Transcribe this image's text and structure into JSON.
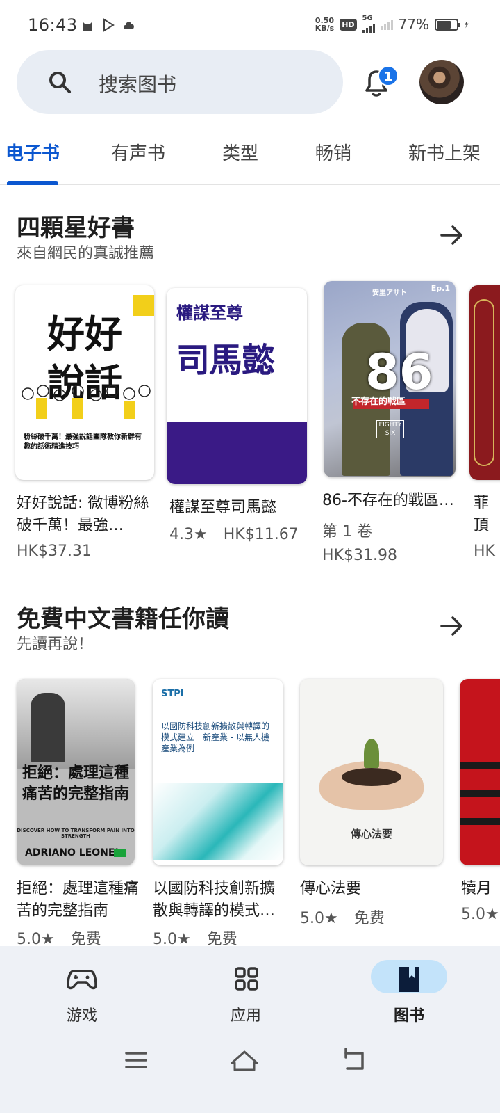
{
  "status_bar": {
    "time": "16:43",
    "net_speed_value": "0.50",
    "net_speed_unit": "KB/s",
    "hd_label": "HD",
    "network_label": "5G",
    "battery_percent": "77%",
    "battery_level": 0.77
  },
  "header": {
    "search_placeholder": "搜索图书",
    "notification_count": "1"
  },
  "tabs": [
    {
      "label": "电子书",
      "active": true
    },
    {
      "label": "有声书",
      "active": false
    },
    {
      "label": "类型",
      "active": false
    },
    {
      "label": "畅销",
      "active": false
    },
    {
      "label": "新书上架",
      "active": false
    }
  ],
  "sections": [
    {
      "title": "四顆星好書",
      "subtitle": "來自網民的真誠推薦",
      "books": [
        {
          "title": "好好說話: 微博粉絲破千萬！最強…",
          "price": "HK$37.31",
          "cover_big": "好好說話",
          "cover_caption": "粉絲破千萬！最強說話團隊教你新鮮有趣的話術精進技巧"
        },
        {
          "title": "權謀至尊司馬懿",
          "rating": "4.3",
          "price": "HK$11.67",
          "cover_line1": "權謀至尊",
          "cover_line2": "司馬懿"
        },
        {
          "title": "86-不存在的戰區…",
          "volume": "第 1 卷",
          "price": "HK$31.98",
          "cover_number": "86",
          "cover_sub": "不存在的戰區",
          "cover_vol": "Ep.1",
          "cover_author": "安里アサト",
          "cover_en": "EIGHTY SIX"
        },
        {
          "title": "菲頂",
          "price": "HK"
        }
      ]
    },
    {
      "title": "免費中文書籍任你讀",
      "subtitle": "先讀再說！",
      "books": [
        {
          "title": "拒絕：處理這種痛苦的完整指南",
          "rating": "5.0",
          "price": "免费",
          "cover_title": "拒絕：處理這種痛苦的完整指南",
          "cover_en": "DISCOVER HOW TO TRANSFORM PAIN INTO STRENGTH",
          "cover_author": "ADRIANO LEONEL"
        },
        {
          "title": "以國防科技創新擴散與轉譯的模式…",
          "rating": "5.0",
          "price": "免费",
          "cover_logo": "STPI",
          "cover_title": "以國防科技創新擴散與轉譯的模式建立一新產業 - 以無人機產業為例"
        },
        {
          "title": "傳心法要",
          "rating": "5.0",
          "price": "免费",
          "cover_title": "傳心法要"
        },
        {
          "title": "犢月",
          "rating": "5.0",
          "price": ""
        }
      ]
    }
  ],
  "bottom_nav": [
    {
      "label": "游戏",
      "icon": "gamepad-icon",
      "active": false
    },
    {
      "label": "应用",
      "icon": "apps-grid-icon",
      "active": false
    },
    {
      "label": "图书",
      "icon": "book-icon",
      "active": true
    }
  ],
  "star_glyph": "★",
  "accent_color": "#0b57d0"
}
